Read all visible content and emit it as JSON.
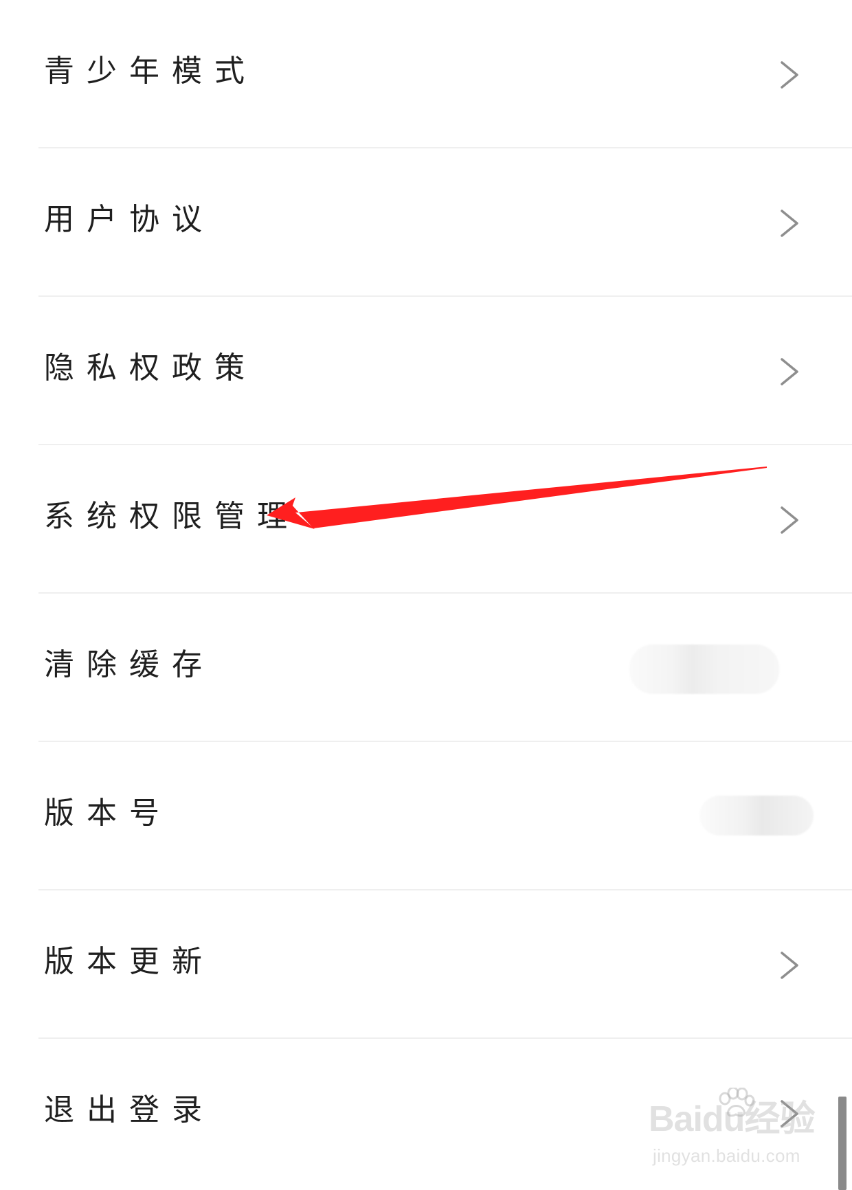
{
  "settings": {
    "items": [
      {
        "label": "青少年模式",
        "has_arrow": true
      },
      {
        "label": "用户协议",
        "has_arrow": true
      },
      {
        "label": "隐私权政策",
        "has_arrow": true
      },
      {
        "label": "系统权限管理",
        "has_arrow": true
      },
      {
        "label": "清除缓存",
        "has_arrow": false
      },
      {
        "label": "版本号",
        "has_arrow": false
      },
      {
        "label": "版本更新",
        "has_arrow": true
      },
      {
        "label": "退出登录",
        "has_arrow": true
      }
    ]
  },
  "annotation": {
    "arrow_color": "#ff1f1f"
  },
  "watermark": {
    "main": "Baidu经验",
    "sub": "jingyan.baidu.com"
  },
  "icons": {
    "chevron": "chevron-right-icon",
    "arrow": "red-pointer-arrow",
    "paw": "paw-icon"
  }
}
